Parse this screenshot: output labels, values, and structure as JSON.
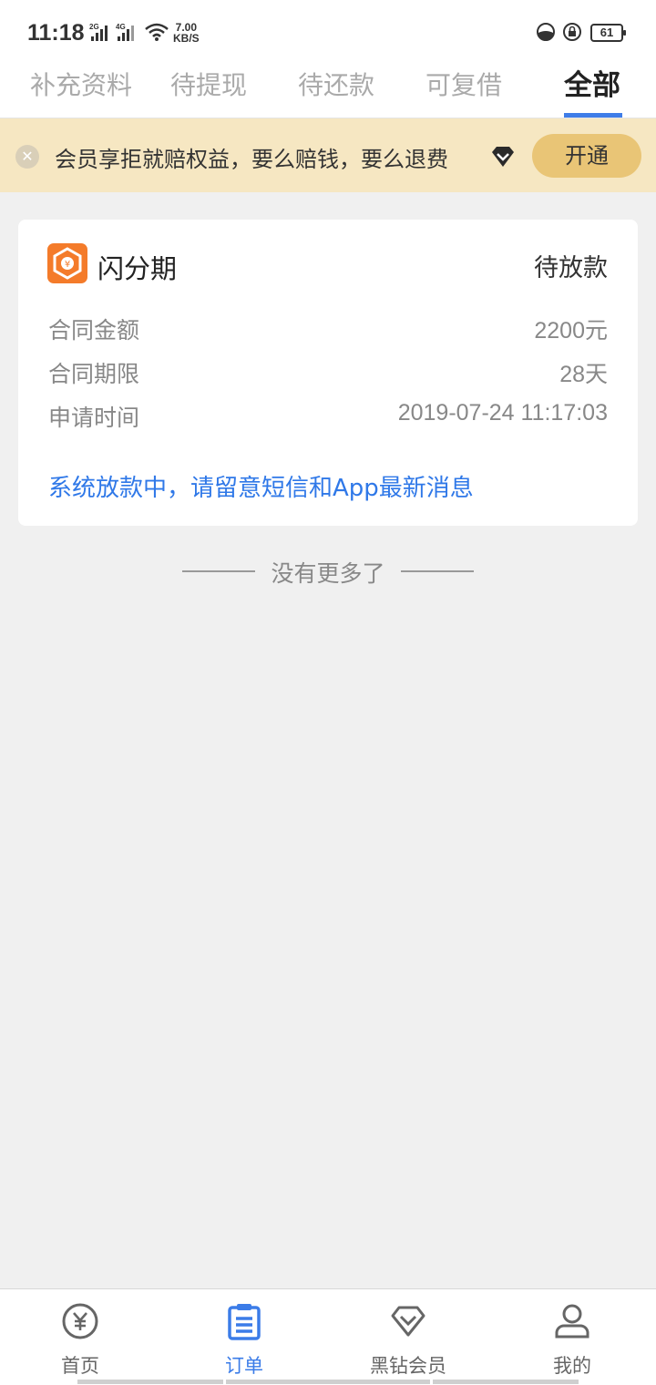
{
  "status_bar": {
    "time": "11:18",
    "net1": "2G",
    "net2": "4G",
    "speed_value": "7.00",
    "speed_unit": "KB/S",
    "battery": "61"
  },
  "tabs": [
    {
      "label": "补充资料",
      "active": false
    },
    {
      "label": "待提现",
      "active": false
    },
    {
      "label": "待还款",
      "active": false
    },
    {
      "label": "可复借",
      "active": false
    },
    {
      "label": "全部",
      "active": true
    }
  ],
  "banner": {
    "text": "会员享拒就赔权益，要么赔钱，要么退费",
    "button": "开通"
  },
  "order": {
    "name": "闪分期",
    "status": "待放款",
    "rows": [
      {
        "label": "合同金额",
        "value": "2200元"
      },
      {
        "label": "合同期限",
        "value": "28天"
      },
      {
        "label": "申请时间",
        "value": "2019-07-24 11:17:03"
      }
    ],
    "notice": "系统放款中，请留意短信和App最新消息"
  },
  "no_more": "没有更多了",
  "bottom_nav": [
    {
      "label": "首页",
      "icon": "yen-circle-icon",
      "active": false
    },
    {
      "label": "订单",
      "icon": "clipboard-icon",
      "active": true
    },
    {
      "label": "黑钻会员",
      "icon": "diamond-icon",
      "active": false
    },
    {
      "label": "我的",
      "icon": "user-icon",
      "active": false
    }
  ],
  "colors": {
    "accent": "#3b7ce8",
    "banner_bg": "#f6e7c2",
    "banner_button": "#e9c576",
    "logo": "#f47b2a"
  }
}
